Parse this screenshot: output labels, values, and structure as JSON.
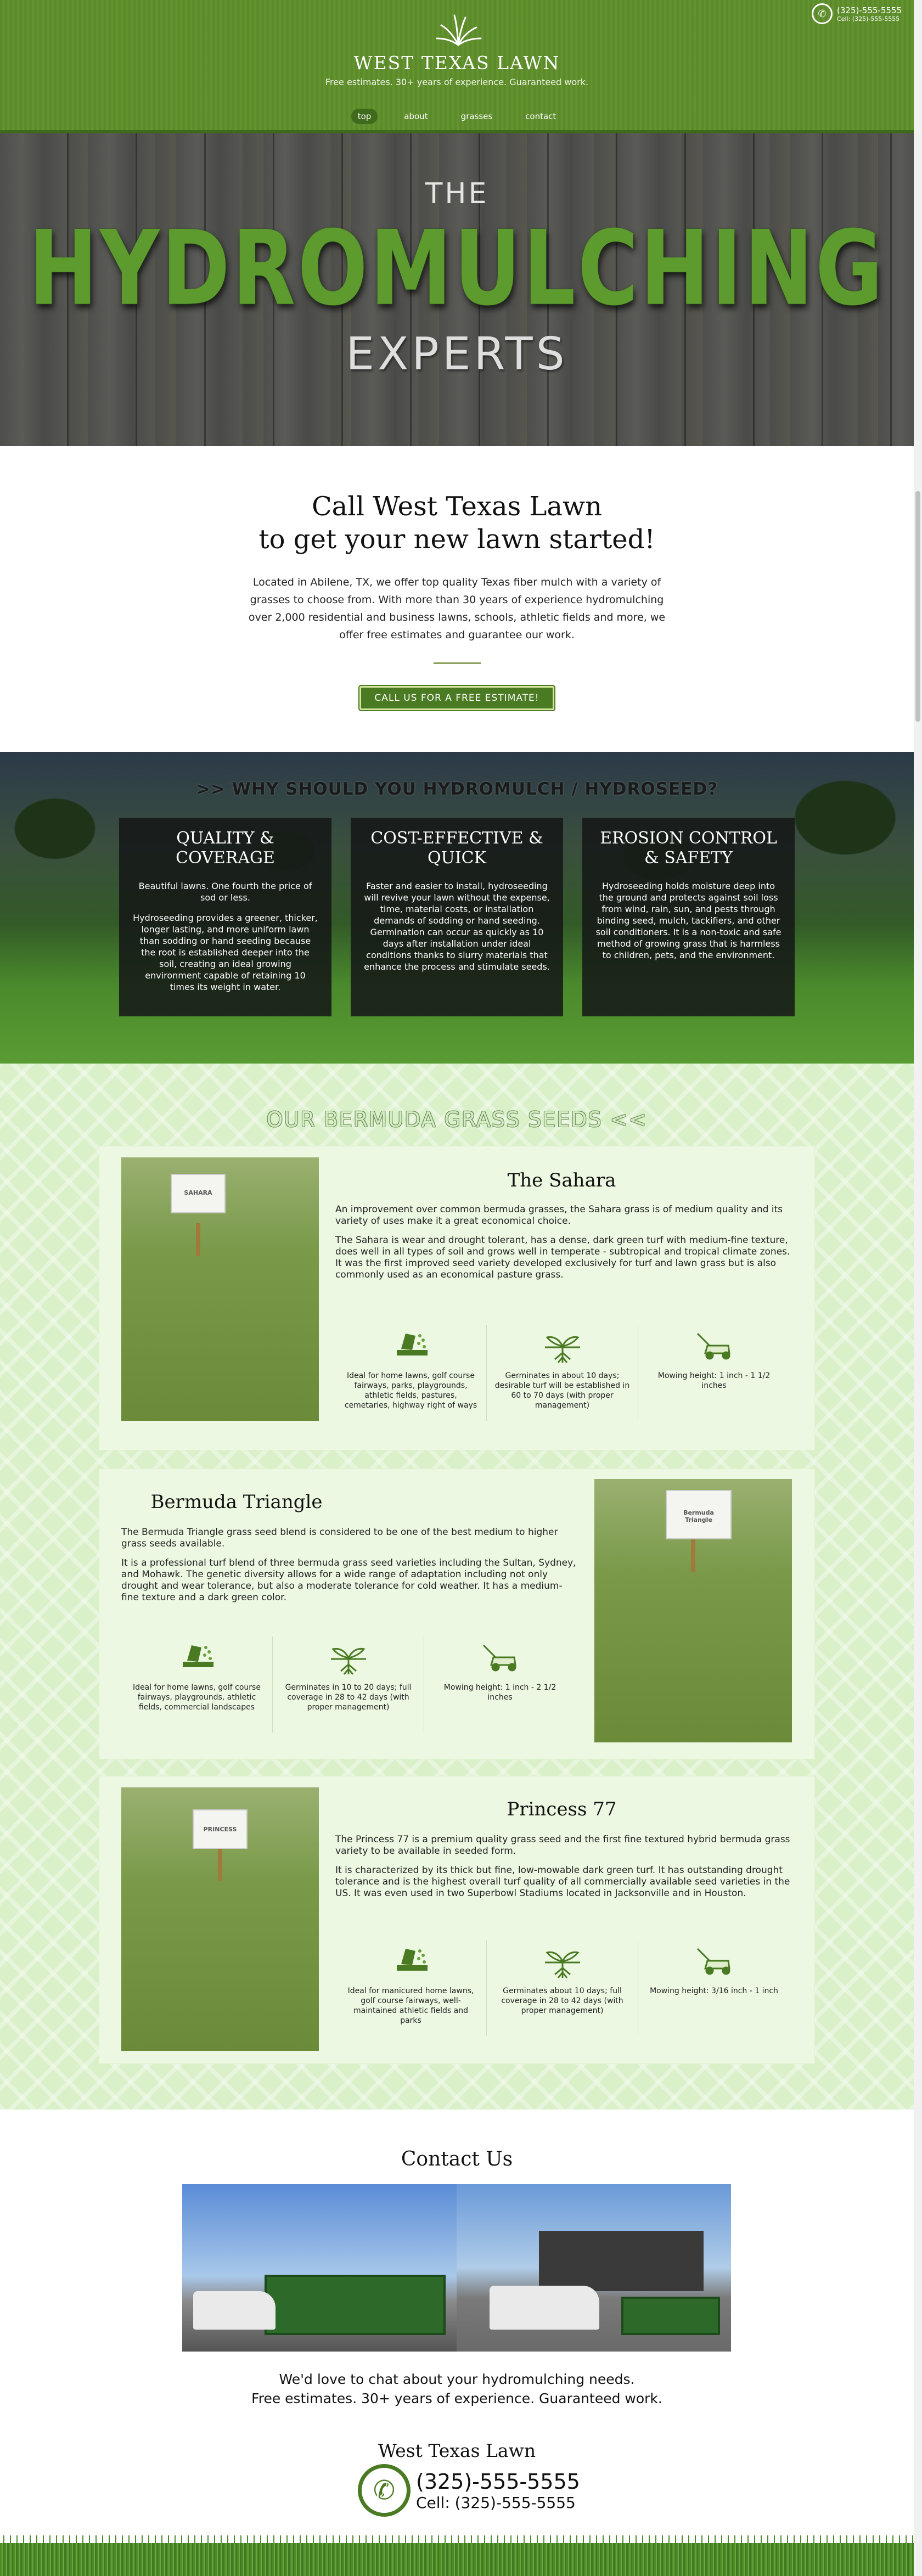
{
  "header": {
    "title": "WEST TEXAS LAWN",
    "tagline": "Free estimates. 30+ years of experience. Guaranteed work.",
    "phone_main": "(325)-555-5555",
    "phone_cell": "Cell: (325)-555-5555",
    "nav": [
      {
        "label": "top",
        "active": true
      },
      {
        "label": "about",
        "active": false
      },
      {
        "label": "grasses",
        "active": false
      },
      {
        "label": "contact",
        "active": false
      }
    ]
  },
  "hero": {
    "line1": "THE",
    "line2": "HYDROMULCHING",
    "line3": "EXPERTS"
  },
  "intro": {
    "heading_1": "Call West Texas Lawn",
    "heading_2": "to get your new lawn started!",
    "body": "Located in Abilene, TX, we offer top quality Texas fiber mulch with a variety of grasses to choose from. With more than 30 years of experience hydromulching over 2,000 residential and business lawns, schools, athletic fields and more, we offer free estimates and guarantee our work.",
    "cta": "CALL US FOR A FREE ESTIMATE!"
  },
  "why": {
    "heading": ">> WHY SHOULD YOU HYDROMULCH / HYDROSEED?",
    "cards": [
      {
        "title": "QUALITY & COVERAGE",
        "p1": "Beautiful lawns. One fourth the price of sod or less.",
        "p2": "Hydroseeding provides a greener, thicker, longer lasting, and more uniform lawn than sodding or hand seeding because the root is established deeper into the soil, creating an ideal growing environment capable of retaining 10 times its weight in water."
      },
      {
        "title": "COST-EFFECTIVE & QUICK",
        "p1": "Faster and easier to install, hydroseeding will revive your lawn without the expense, time, material costs, or installation demands of sodding or hand seeding. Germination can occur as quickly as 10 days after installation under ideal conditions thanks to slurry materials that enhance the process and stimulate seeds.",
        "p2": ""
      },
      {
        "title": "EROSION CONTROL & SAFETY",
        "p1": "Hydroseeding holds moisture deep into the ground and protects against soil loss from wind, rain, sun, and pests through binding seed, mulch, tackifiers, and other soil conditioners. It is a non-toxic and safe method of growing grass that is harmless to children, pets, and the environment.",
        "p2": ""
      }
    ]
  },
  "grasses": {
    "heading": "OUR BERMUDA GRASS SEEDS <<",
    "items": [
      {
        "name": "The Sahara",
        "sign": "SAHARA",
        "p1": "An improvement over common bermuda grasses, the Sahara grass is of medium quality and its variety of uses make it a great economical choice.",
        "p2": "The Sahara is wear and drought tolerant, has a dense, dark green turf with medium-fine texture, does well in all types of soil and grows well in temperate - subtropical and tropical climate zones. It was the first improved seed variety developed exclusively for turf and lawn grass but is also commonly used as an economical pasture grass.",
        "f1": "Ideal for home lawns, golf course fairways, parks, playgrounds, athletic fields, pastures, cemetaries, highway right of ways",
        "f2": "Germinates in about 10 days; desirable turf will be established in 60 to 70 days (with proper management)",
        "f3": "Mowing height: 1 inch - 1 1/2 inches"
      },
      {
        "name": "Bermuda Triangle",
        "sign": "Bermuda Triangle",
        "p1": "The Bermuda Triangle grass seed blend is considered to be one of the best medium to higher grass seeds available.",
        "p2": "It is a professional turf blend of three bermuda grass seed varieties including the Sultan, Sydney, and Mohawk. The genetic diversity allows for a wide range of adaptation including not only drought and wear tolerance, but also a moderate tolerance for cold weather. It has a medium-fine texture and a dark green color.",
        "f1": "Ideal for home lawns, golf course fairways, playgrounds, athletic fields, commercial landscapes",
        "f2": "Germinates in 10 to 20 days; full coverage in 28 to 42 days (with proper management)",
        "f3": "Mowing height: 1 inch - 2 1/2 inches"
      },
      {
        "name": "Princess 77",
        "sign": "PRINCESS",
        "p1": "The Princess 77 is a premium quality grass seed and the first fine textured hybrid bermuda grass variety to be available in seeded form.",
        "p2": "It is characterized by its thick but fine, low-mowable dark green turf. It has outstanding drought tolerance and is the highest overall turf quality of all commercially available seed varieties in the US. It was even used in two Superbowl Stadiums located in Jacksonville and in Houston.",
        "f1": "Ideal for manicured home lawns, golf course fairways, well-maintained athletic fields and parks",
        "f2": "Germinates about 10 days; full coverage in 28 to 42 days (with proper management)",
        "f3": "Mowing height: 3/16 inch - 1 inch"
      }
    ]
  },
  "contact": {
    "heading": "Contact Us",
    "lead_1": "We'd love to chat about your hydromulching needs.",
    "lead_2": "Free estimates. 30+ years of experience. Guaranteed work.",
    "business": "West Texas Lawn",
    "phone_main": "(325)-555-5555",
    "phone_cell": "Cell: (325)-555-5555"
  },
  "icons": {
    "phone": "phone-icon",
    "seed": "seed-bag-icon",
    "sprout": "sprout-roots-icon",
    "mower": "lawn-mower-icon"
  },
  "colors": {
    "brand_green": "#4a7a22",
    "header_green": "#5c8a2e",
    "light_green_bg": "#d9f0c8"
  }
}
